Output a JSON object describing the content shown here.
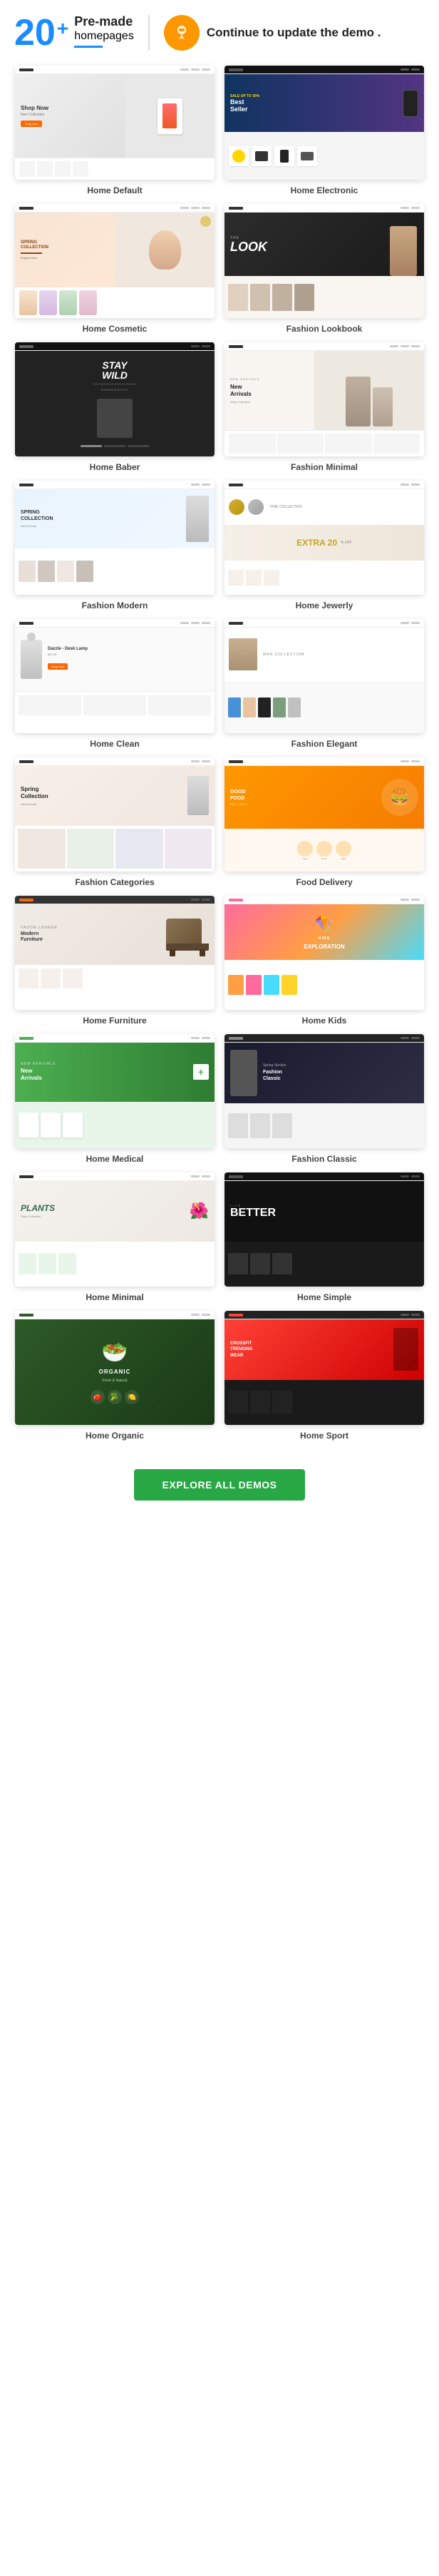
{
  "header": {
    "count": "20",
    "plus": "+",
    "premade_label": "Pre-made",
    "homepages_label": "homepages",
    "continue_label": "Continue to update the demo .",
    "blue_underline": true
  },
  "explore_btn": {
    "label": "EXPLORE ALL DEMOS"
  },
  "demos": [
    {
      "id": "home-default",
      "label": "Home Default",
      "type": "home-default"
    },
    {
      "id": "home-electronic",
      "label": "Home Electronic",
      "type": "home-electronic"
    },
    {
      "id": "home-cosmetic",
      "label": "Home Cosmetic",
      "type": "home-cosmetic"
    },
    {
      "id": "fashion-lookbook",
      "label": "Fashion Lookbook",
      "type": "fashion-lookbook"
    },
    {
      "id": "home-baber",
      "label": "Home Baber",
      "type": "home-baber"
    },
    {
      "id": "fashion-minimal",
      "label": "Fashion Minimal",
      "type": "fashion-minimal"
    },
    {
      "id": "fashion-modern",
      "label": "Fashion Modern",
      "type": "fashion-modern"
    },
    {
      "id": "home-jewelry",
      "label": "Home Jewerly",
      "type": "home-jewelry"
    },
    {
      "id": "home-clean",
      "label": "Home Clean",
      "type": "home-clean"
    },
    {
      "id": "fashion-elegant",
      "label": "Fashion Elegant",
      "type": "fashion-elegant"
    },
    {
      "id": "fashion-categories",
      "label": "Fashion Categories",
      "type": "fashion-categories"
    },
    {
      "id": "food-delivery",
      "label": "Food Delivery",
      "type": "food-delivery"
    },
    {
      "id": "home-furniture",
      "label": "Home Furniture",
      "type": "home-furniture"
    },
    {
      "id": "home-kids",
      "label": "Home Kids",
      "type": "home-kids"
    },
    {
      "id": "home-medical",
      "label": "Home Medical",
      "type": "home-medical"
    },
    {
      "id": "fashion-classic",
      "label": "Fashion Classic",
      "type": "fashion-classic"
    },
    {
      "id": "home-minimal",
      "label": "Home Minimal",
      "type": "home-minimal"
    },
    {
      "id": "home-simple",
      "label": "Home Simple",
      "type": "home-simple"
    },
    {
      "id": "home-organic",
      "label": "Home Organic",
      "type": "home-organic"
    },
    {
      "id": "home-sport",
      "label": "Home Sport",
      "type": "home-sport"
    }
  ]
}
